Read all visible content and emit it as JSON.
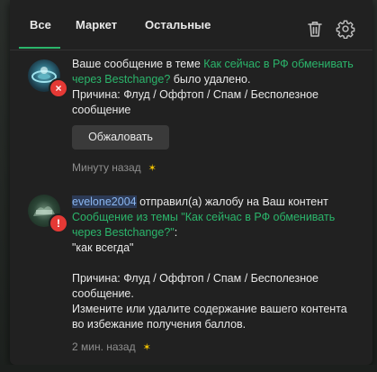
{
  "tabs": [
    {
      "label": "Все",
      "active": true
    },
    {
      "label": "Маркет",
      "active": false
    },
    {
      "label": "Остальные",
      "active": false
    }
  ],
  "header_icons": {
    "trash": "trash-icon",
    "settings": "gear-icon"
  },
  "colors": {
    "accent": "#2bb56b",
    "badge_red": "#e53935",
    "star": "#f2c200"
  },
  "notifications": [
    {
      "text_before": "Ваше сообщение в теме ",
      "link": "Как сейчас в РФ обменивать через Bestchange?",
      "text_after": " было удалено.",
      "reason": "Причина: Флуд / Оффтоп / Спам / Бесполезное сообщение",
      "button_label": "Обжаловать",
      "time": "Минуту назад",
      "star": "✶",
      "badge": "×"
    },
    {
      "user": "evelone2004",
      "text_after_user": " отправил(а) жалобу на Ваш контент",
      "link": "Сообщение из темы \"Как сейчас в РФ обменивать через Bestchange?\"",
      "colon": ":",
      "quote": "\"как всегда\"",
      "reason": "Причина: Флуд / Оффтоп / Спам / Бесполезное сообщение.",
      "advice": "Измените или удалите содержание вашего контента во избежание получения баллов.",
      "time": "2 мин. назад",
      "star": "✶",
      "badge": "!"
    }
  ]
}
